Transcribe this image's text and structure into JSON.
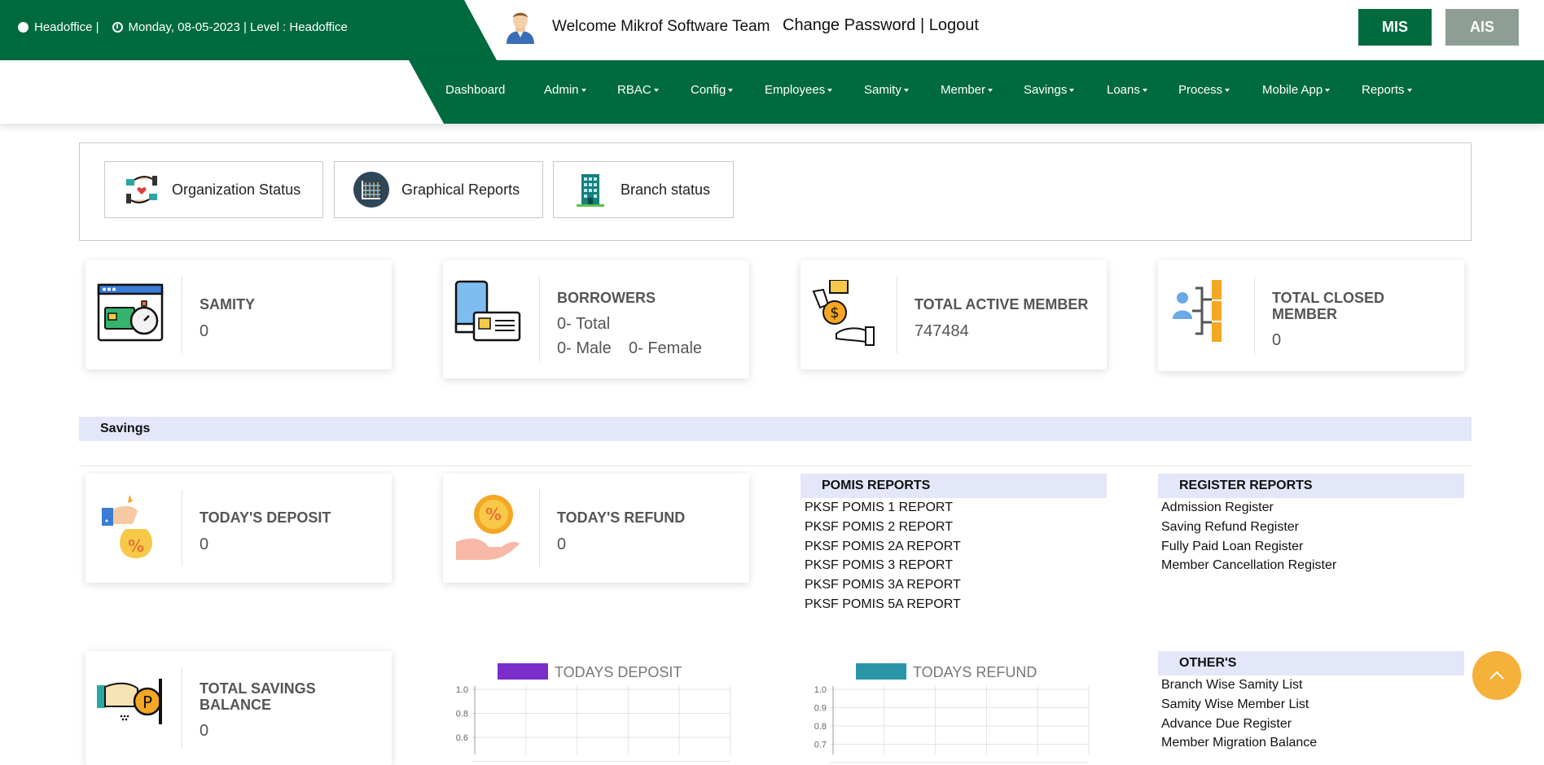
{
  "header": {
    "office": "Headoffice |",
    "date_info": "Monday, 08-05-2023 | Level : Headoffice",
    "welcome": "Welcome Mikrof Software Team",
    "change_password": "Change Password",
    "separator": " | ",
    "logout": "Logout",
    "mis": "MIS",
    "ais": "AIS",
    "icons": [
      "globe-icon",
      "clock-icon",
      "user-avatar"
    ],
    "green": "#006a3f"
  },
  "nav": [
    {
      "label": "Dashboard",
      "dropdown": false
    },
    {
      "label": "Admin",
      "dropdown": true
    },
    {
      "label": "RBAC",
      "dropdown": true
    },
    {
      "label": "Config",
      "dropdown": true
    },
    {
      "label": "Employees",
      "dropdown": true
    },
    {
      "label": "Samity",
      "dropdown": true
    },
    {
      "label": "Member",
      "dropdown": true
    },
    {
      "label": "Savings",
      "dropdown": true
    },
    {
      "label": "Loans",
      "dropdown": true
    },
    {
      "label": "Process",
      "dropdown": true
    },
    {
      "label": "Mobile App",
      "dropdown": true
    },
    {
      "label": "Reports",
      "dropdown": true
    }
  ],
  "tabs": {
    "organization": "Organization Status",
    "graphical": "Graphical Reports",
    "branch": "Branch status"
  },
  "stats": {
    "samity": {
      "title": "SAMITY",
      "value": "0"
    },
    "borrowers": {
      "title": "BORROWERS",
      "total": "0- Total",
      "male": "0- Male",
      "female": "0- Female"
    },
    "active_member": {
      "title": "TOTAL ACTIVE MEMBER",
      "value": "747484"
    },
    "closed_member": {
      "title_line1": "TOTAL CLOSED",
      "title_line2": "MEMBER",
      "value": "0"
    }
  },
  "savings": {
    "section_title": "Savings",
    "todays_deposit": {
      "title": "TODAY'S DEPOSIT",
      "value": "0"
    },
    "todays_refund": {
      "title": "TODAY'S REFUND",
      "value": "0"
    },
    "total_balance": {
      "title_line1": "TOTAL SAVINGS",
      "title_line2": "BALANCE",
      "value": "0"
    }
  },
  "reports": {
    "pomis": {
      "title": "POMIS REPORTS",
      "items": [
        "PKSF POMIS 1 REPORT",
        "PKSF POMIS 2 REPORT",
        "PKSF POMIS 2A REPORT",
        "PKSF POMIS 3 REPORT",
        "PKSF POMIS 3A REPORT",
        "PKSF POMIS 5A REPORT"
      ]
    },
    "register": {
      "title": "REGISTER REPORTS",
      "items": [
        "Admission Register",
        "Saving Refund Register",
        "Fully Paid Loan Register",
        "Member Cancellation Register"
      ]
    },
    "others": {
      "title": "OTHER'S",
      "items": [
        "Branch Wise Samity List",
        "Samity Wise Member List",
        "Advance Due Register",
        "Member Migration Balance"
      ]
    }
  },
  "chart_data": [
    {
      "type": "bar",
      "title": "",
      "series": [
        {
          "name": "TODAYS DEPOSIT",
          "values": [],
          "color": "#7b2ec9"
        }
      ],
      "categories": [],
      "y_ticks_visible": [
        "1.0",
        "0.8",
        "0.6"
      ],
      "ylim": [
        0,
        1.0
      ],
      "grid": true
    },
    {
      "type": "bar",
      "title": "",
      "series": [
        {
          "name": "TODAYS REFUND",
          "values": [],
          "color": "#2b95a8"
        }
      ],
      "categories": [],
      "y_ticks_visible": [
        "1.0",
        "0.9",
        "0.8",
        "0.7"
      ],
      "ylim": [
        0,
        1.0
      ],
      "grid": true
    }
  ]
}
